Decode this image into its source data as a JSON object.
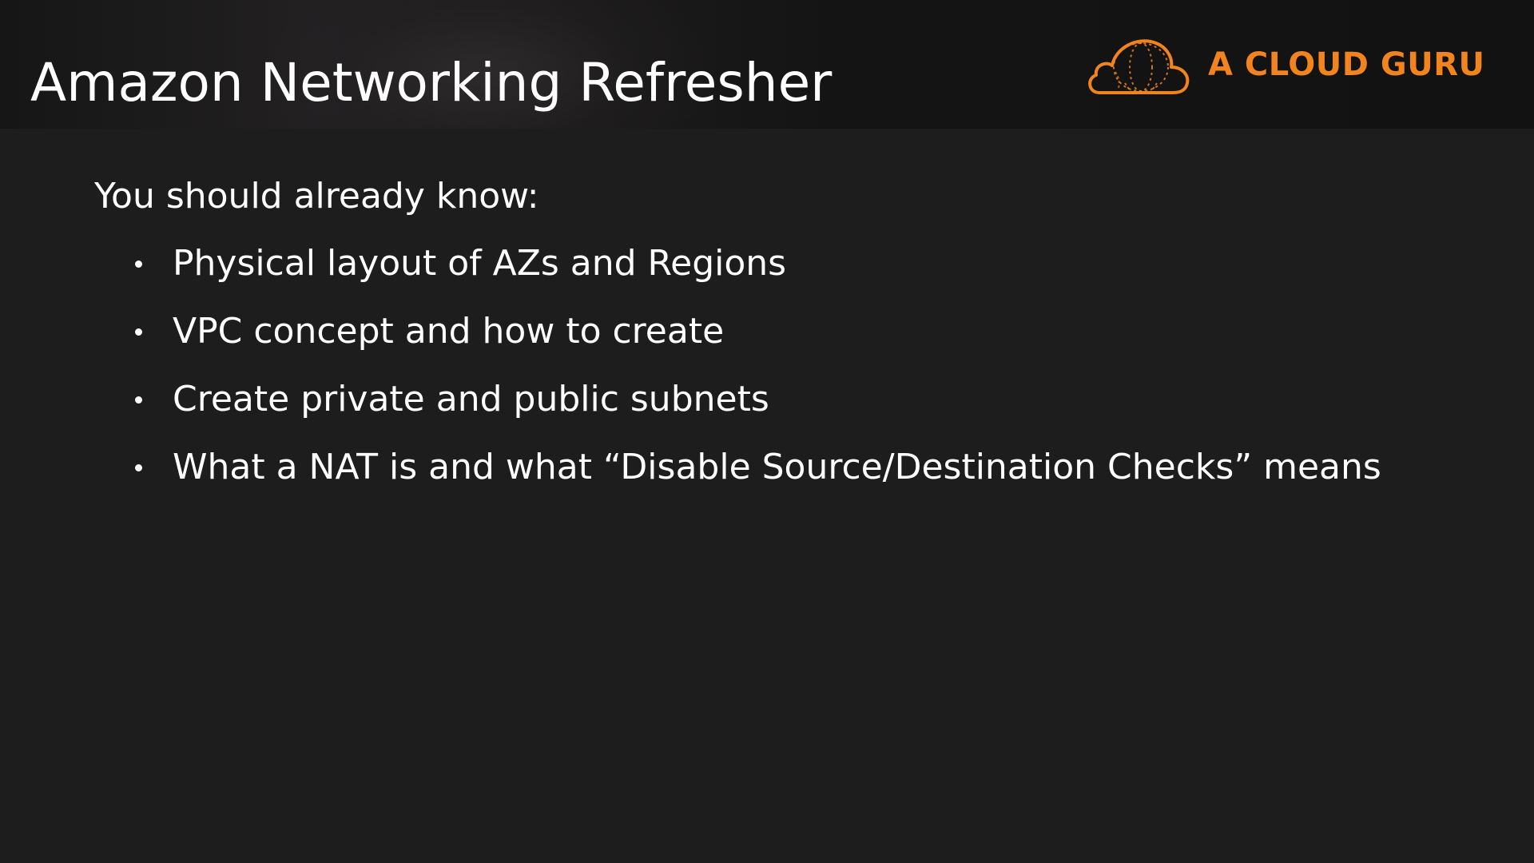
{
  "header": {
    "title": "Amazon Networking Refresher"
  },
  "logo": {
    "icon": "cloud-balloon-icon",
    "text": "A CLOUD GURU",
    "color": "#f2841f"
  },
  "content": {
    "intro": "You should already know:",
    "bullets": [
      "Physical layout of AZs and Regions",
      "VPC concept and how to create",
      "Create private and public subnets",
      "What a NAT is and what “Disable Source/Destination Checks” means"
    ]
  },
  "colors": {
    "background": "#1d1d1d",
    "text": "#ffffff",
    "accent": "#f2841f"
  }
}
